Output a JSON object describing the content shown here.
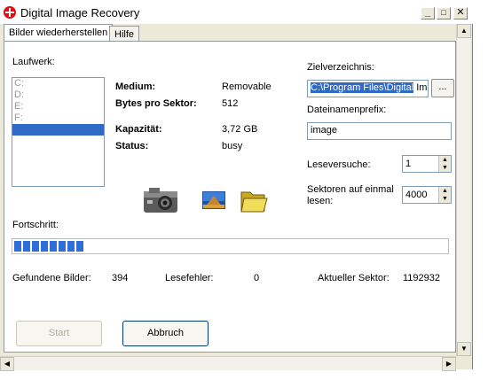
{
  "window": {
    "title": "Digital Image Recovery",
    "minimize": "_",
    "maximize": "□",
    "close": "✕"
  },
  "tabs": [
    {
      "label": "Bilder wiederherstellen"
    },
    {
      "label": "Hilfe"
    }
  ],
  "drive": {
    "label": "Laufwerk:",
    "items": [
      "C:",
      "D:",
      "E:",
      "F:",
      ""
    ]
  },
  "info": {
    "medium_label": "Medium:",
    "medium_value": "Removable",
    "bps_label": "Bytes pro Sektor:",
    "bps_value": "512",
    "capacity_label": "Kapazität:",
    "capacity_value": "3,72 GB",
    "status_label": "Status:",
    "status_value": "busy"
  },
  "target": {
    "label": "Zielverzeichnis:",
    "value_selected": "C:\\Program Files\\Digital",
    "value_rest": " Ima",
    "browse_label": "..."
  },
  "prefix": {
    "label": "Dateinamenprefix:",
    "value": "image"
  },
  "retries": {
    "label": "Leseversuche:",
    "value": "1"
  },
  "sectors": {
    "label": "Sektoren auf einmal lesen:",
    "value": "4000"
  },
  "progress": {
    "label": "Fortschritt:",
    "value_fraction": 0.16
  },
  "stats": {
    "found_label": "Gefundene Bilder:",
    "found_value": "394",
    "errors_label": "Lesefehler:",
    "errors_value": "0",
    "sector_label": "Aktueller Sektor:",
    "sector_value": "1192932"
  },
  "buttons": {
    "start": "Start",
    "cancel": "Abbruch"
  },
  "icons": [
    "camera-icon",
    "picture-icon",
    "folder-icon"
  ]
}
